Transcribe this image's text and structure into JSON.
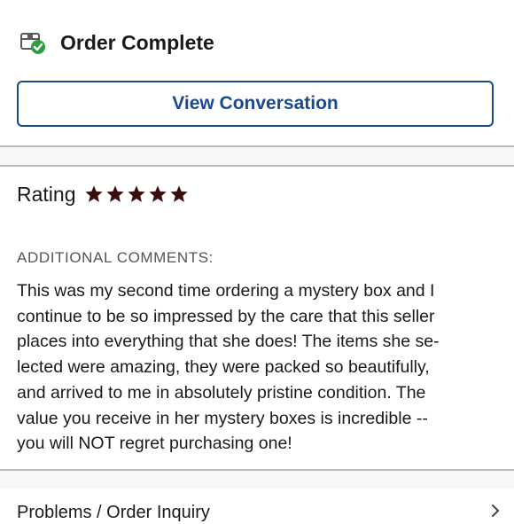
{
  "order": {
    "status_title": "Order Complete",
    "status_icon": "box-check-icon"
  },
  "actions": {
    "view_conversation_label": "View Conversation"
  },
  "rating": {
    "label": "Rating",
    "stars": 5,
    "max_stars": 5,
    "star_color": "#3a0c0c"
  },
  "comments": {
    "heading": "ADDITIONAL COMMENTS:",
    "lines": [
      "This was my second time ordering a mystery box and I",
      "continue to be so impressed by the care that this seller",
      "places into everything that she does! The items she se-",
      "lected were amazing, they were packed so beautifully,",
      "and arrived to me in absolutely pristine condition. The",
      "value you receive in her mystery boxes is incredible --",
      "you will NOT regret purchasing one!"
    ]
  },
  "footer": {
    "problems_label": "Problems / Order Inquiry",
    "chevron_icon": "chevron-right-icon"
  },
  "colors": {
    "accent": "#1b4a8c",
    "success": "#2e9e44",
    "divider": "#bdbdbd"
  }
}
